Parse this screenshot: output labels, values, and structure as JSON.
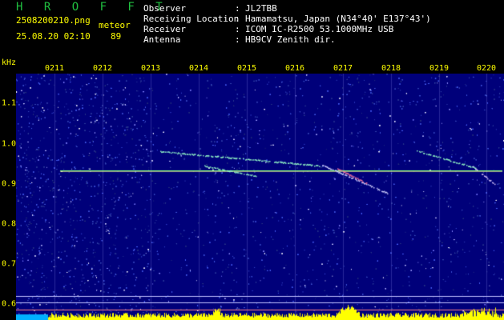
{
  "header": {
    "logo": "H R O F F T",
    "filename": "2508200210.png",
    "datetime": "25.08.20 02:10",
    "meteor_label": "meteor",
    "meteor_count": "89",
    "info": [
      {
        "label": "Observer",
        "value": "JL2TBB"
      },
      {
        "label": "Receiving Location",
        "value": "Hamamatsu, Japan (N34°40' E137°43')"
      },
      {
        "label": "Receiver",
        "value": "ICOM IC-R2500 53.1000MHz USB"
      },
      {
        "label": "Antenna",
        "value": "HB9CV Zenith dir."
      }
    ]
  },
  "axes": {
    "y_unit": "kHz",
    "x_ticks": [
      "0211",
      "0212",
      "0213",
      "0214",
      "0215",
      "0216",
      "0217",
      "0218",
      "0219",
      "0220"
    ],
    "y_ticks": [
      "1.1",
      "1.0",
      "0.9",
      "0.8",
      "0.7",
      "0.6"
    ]
  },
  "colors": {
    "logo": "#20c040",
    "file_text": "#ffff00",
    "header_text": "#ffffff",
    "tick_text": "#ffff00",
    "background_noise": "#00007a",
    "carrier": "#80ff80",
    "amplitude": "#ffff00",
    "amplitude_base": "#00b0ff"
  }
}
